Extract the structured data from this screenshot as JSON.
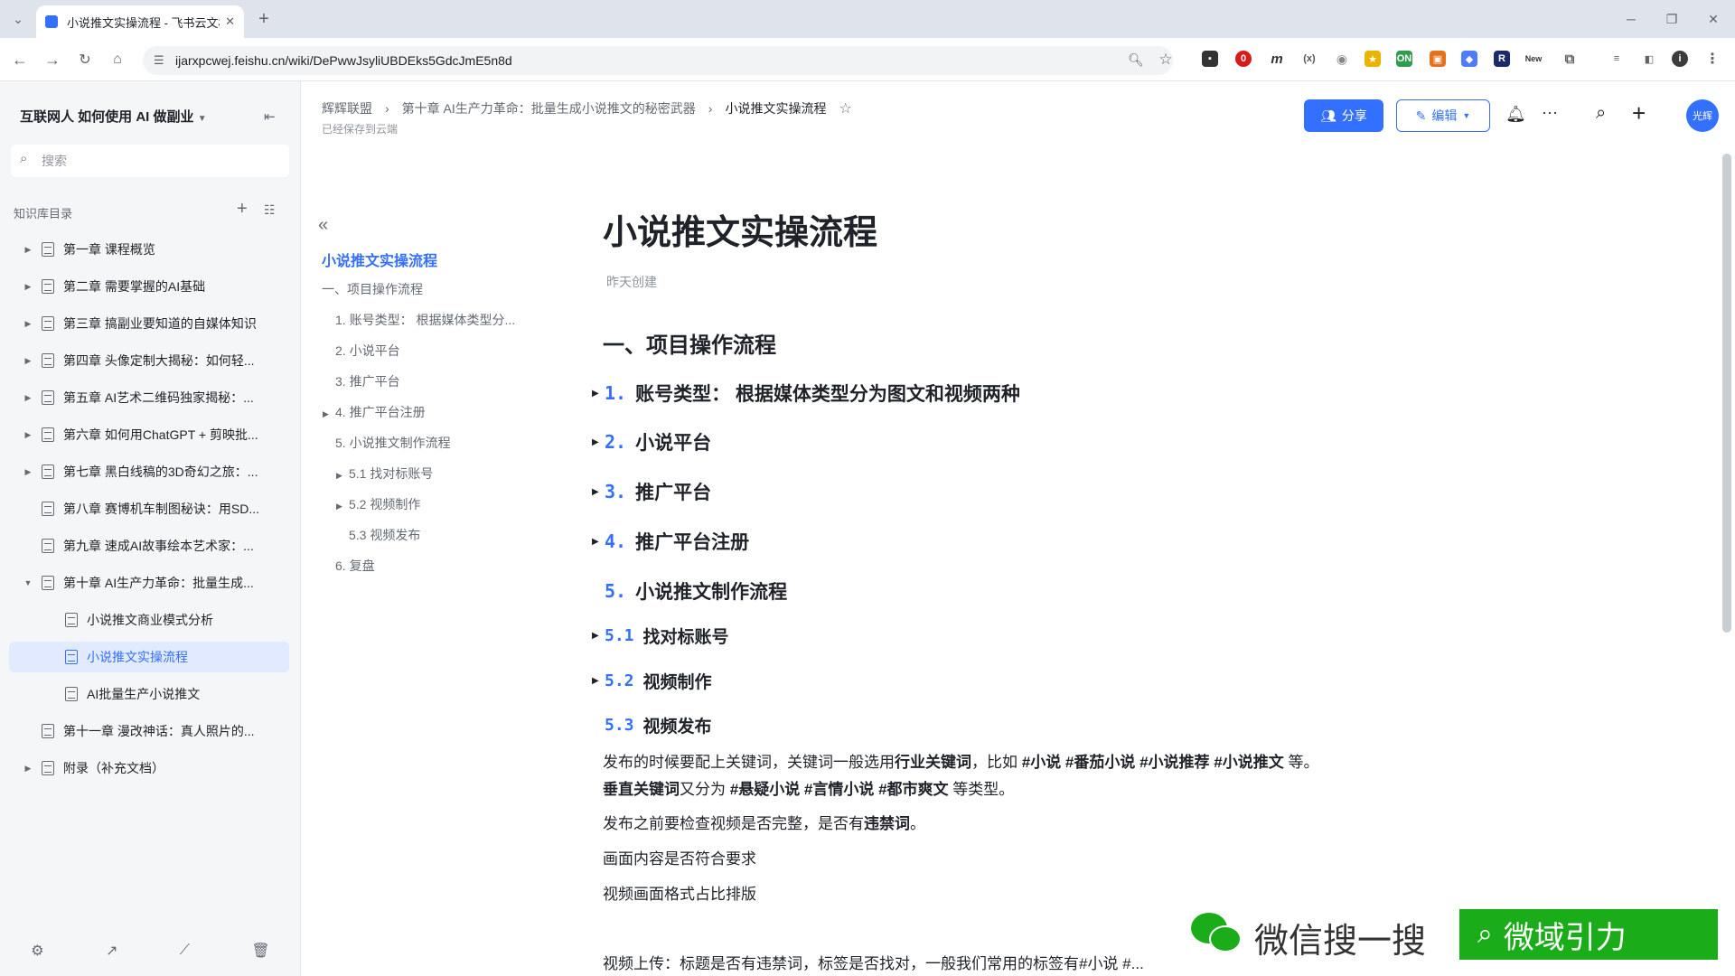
{
  "browser": {
    "tab_title": "小说推文实操流程 - 飞书云文档",
    "url": "ijarxpcwej.feishu.cn/wiki/DePwwJsyliUBDEks5GdcJmE5n8d"
  },
  "sidebar": {
    "space_title": "互联网人 如何使用 AI 做副业",
    "search_placeholder": "搜索",
    "section_label": "知识库目录",
    "items": [
      {
        "label": "第一章 课程概览",
        "caret": "▶"
      },
      {
        "label": "第二章 需要掌握的AI基础",
        "caret": "▶"
      },
      {
        "label": "第三章 搞副业要知道的自媒体知识",
        "caret": "▶"
      },
      {
        "label": "第四章 头像定制大揭秘：如何轻...",
        "caret": "▶"
      },
      {
        "label": "第五章 AI艺术二维码独家揭秘：...",
        "caret": "▶"
      },
      {
        "label": "第六章 如何用ChatGPT + 剪映批...",
        "caret": "▶"
      },
      {
        "label": "第七章 黑白线稿的3D奇幻之旅：...",
        "caret": "▶"
      },
      {
        "label": "第八章 赛博机车制图秘诀：用SD...",
        "caret": ""
      },
      {
        "label": "第九章 速成AI故事绘本艺术家：...",
        "caret": ""
      },
      {
        "label": "第十章 AI生产力革命：批量生成...",
        "caret": "▼"
      },
      {
        "label": "小说推文商业模式分析",
        "caret": ""
      },
      {
        "label": "小说推文实操流程",
        "caret": ""
      },
      {
        "label": "AI批量生产小说推文",
        "caret": ""
      },
      {
        "label": "第十一章 漫改神话：真人照片的...",
        "caret": ""
      },
      {
        "label": "附录（补充文档）",
        "caret": "▶"
      }
    ]
  },
  "header": {
    "breadcrumb": [
      "辉辉联盟",
      "第十章 AI生产力革命：批量生成小说推文的秘密武器",
      "小说推文实操流程"
    ],
    "saved_status": "已经保存到云端",
    "share_label": "分享",
    "edit_label": "编辑",
    "avatar_text": "光辉"
  },
  "toc": {
    "title": "小说推文实操流程",
    "items": [
      {
        "label": "一、项目操作流程",
        "caret": ""
      },
      {
        "label": "1. 账号类型：  根据媒体类型分...",
        "caret": ""
      },
      {
        "label": "2. 小说平台",
        "caret": ""
      },
      {
        "label": "3. 推广平台",
        "caret": ""
      },
      {
        "label": "4. 推广平台注册",
        "caret": "▶"
      },
      {
        "label": "5. 小说推文制作流程",
        "caret": ""
      },
      {
        "label": "5.1 找对标账号",
        "caret": "▶"
      },
      {
        "label": "5.2 视频制作",
        "caret": "▶"
      },
      {
        "label": "5.3 视频发布",
        "caret": ""
      },
      {
        "label": "6. 复盘",
        "caret": ""
      }
    ]
  },
  "document": {
    "title": "小说推文实操流程",
    "meta": "昨天创建",
    "h1": "一、项目操作流程",
    "sections": [
      {
        "num": "1.",
        "text": "账号类型：  根据媒体类型分为图文和视频两种",
        "toggle": "▶"
      },
      {
        "num": "2.",
        "text": "小说平台",
        "toggle": "▶"
      },
      {
        "num": "3.",
        "text": "推广平台",
        "toggle": "▶"
      },
      {
        "num": "4.",
        "text": "推广平台注册",
        "toggle": "▶"
      },
      {
        "num": "5.",
        "text": "小说推文制作流程",
        "toggle": ""
      }
    ],
    "subsections": [
      {
        "num": "5.1",
        "text": "找对标账号",
        "toggle": "▶"
      },
      {
        "num": "5.2",
        "text": "视频制作",
        "toggle": "▶"
      },
      {
        "num": "5.3",
        "text": "视频发布",
        "toggle": ""
      }
    ],
    "para1": {
      "a": "发布的时候要配上关键词，关键词一般选用",
      "b": "行业关键词",
      "c": "，比如 ",
      "d": "#小说  #番茄小说  #小说推荐  #小说推文",
      "e": " 等。"
    },
    "para2": {
      "a": "垂直关键词",
      "b": "又分为 ",
      "c": "#悬疑小说  #言情小说  #都市爽文",
      "d": " 等类型。"
    },
    "para3": {
      "a": "发布之前要检查视频是否完整，是否有",
      "b": "违禁词",
      "c": "。"
    },
    "para4": "画面内容是否符合要求",
    "para5": "视频画面格式占比排版",
    "para6": "视频上传：标题是否有违禁词，标签是否找对，一般我们常用的标签有#小说 #..."
  },
  "watermark": {
    "left_text": "微信搜一搜",
    "right_text": "微域引力"
  },
  "colors": {
    "accent": "#3370ff",
    "wechat_green": "#1aad19",
    "sidebar_bg": "#f5f6f7"
  }
}
